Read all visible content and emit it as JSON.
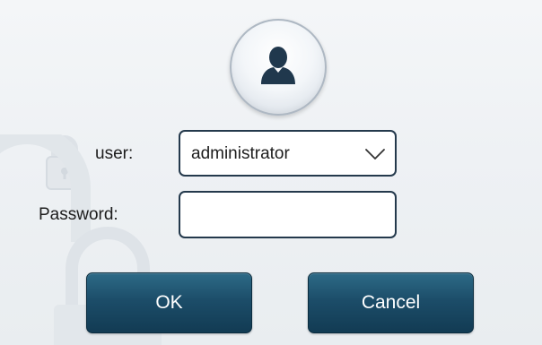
{
  "login_dialog": {
    "avatar_icon": "user-icon",
    "user_label": "user:",
    "user_value": "administrator",
    "user_dropdown_icon": "chevron-down-icon",
    "password_label": "Password:",
    "password_value": "",
    "ok_label": "OK",
    "cancel_label": "Cancel"
  },
  "colors": {
    "button_top": "#2d6a87",
    "button_bottom": "#123b53",
    "field_border": "#24394c",
    "avatar_icon": "#20384d",
    "background": "#f0f3f6"
  }
}
